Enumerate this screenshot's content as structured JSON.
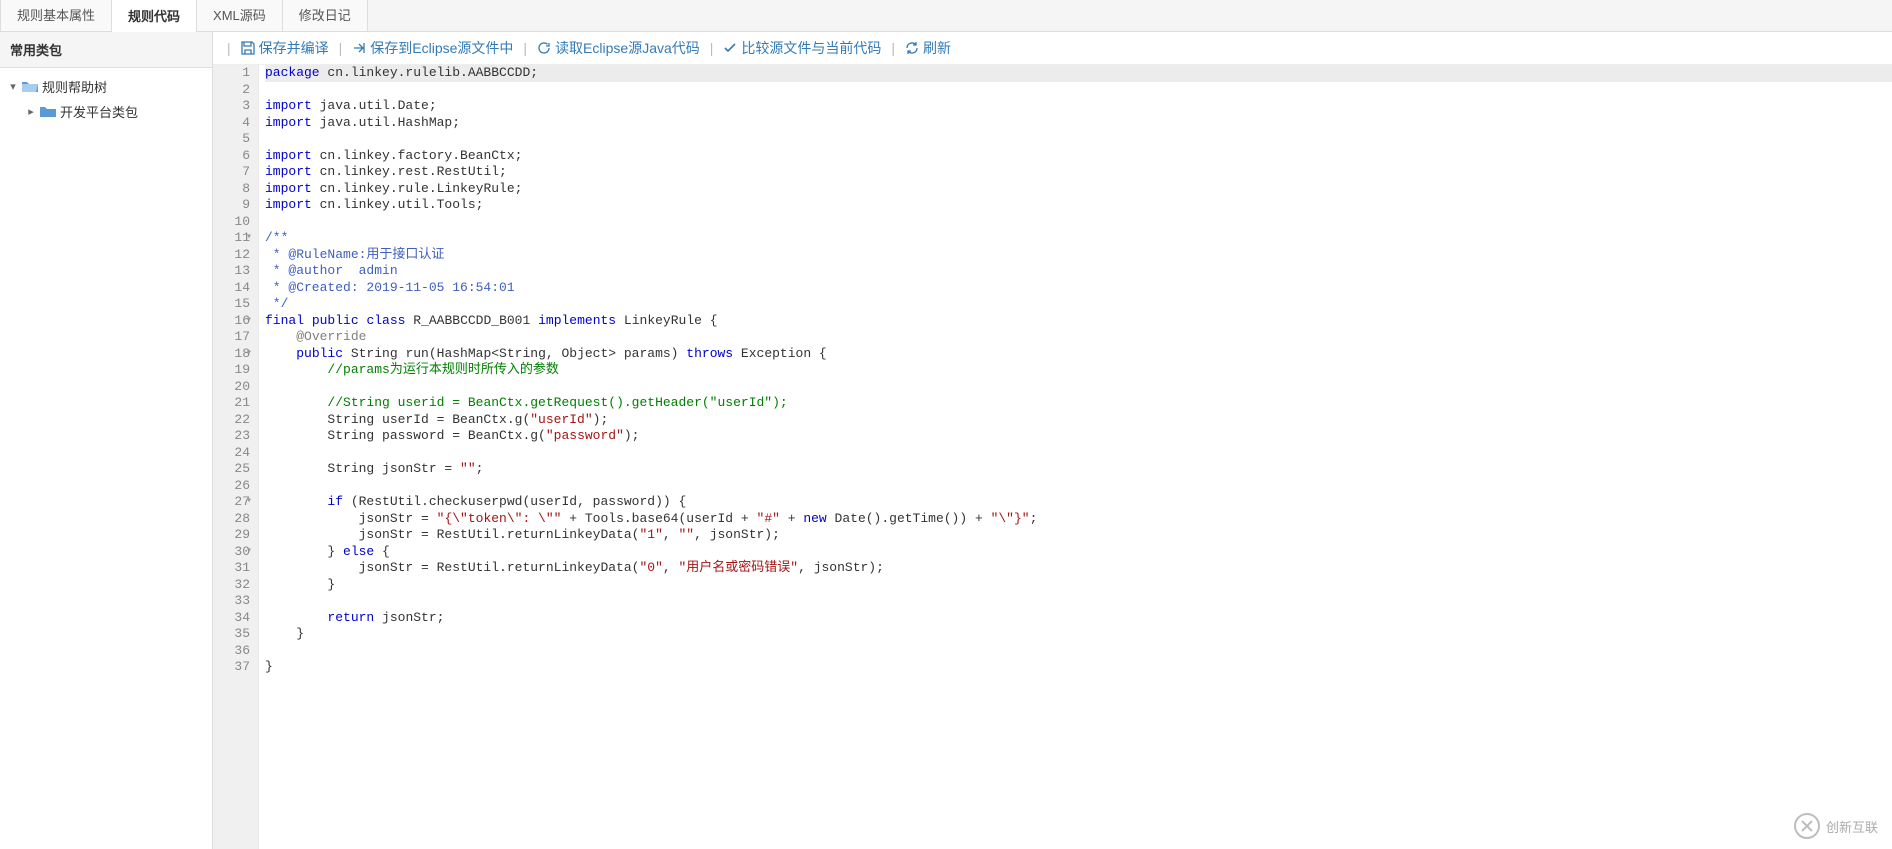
{
  "tabs": [
    {
      "label": "规则基本属性"
    },
    {
      "label": "规则代码"
    },
    {
      "label": "XML源码"
    },
    {
      "label": "修改日记"
    }
  ],
  "activeTabIndex": 1,
  "sidebar": {
    "header": "常用类包",
    "tree": {
      "root": {
        "label": "规则帮助树"
      },
      "child": {
        "label": "开发平台类包"
      }
    }
  },
  "toolbar": {
    "saveCompile": "保存并编译",
    "saveToEclipse": "保存到Eclipse源文件中",
    "readEclipse": "读取Eclipse源Java代码",
    "compareSource": "比较源文件与当前代码",
    "refresh": "刷新"
  },
  "code": {
    "highlightLine": 1,
    "foldLines": [
      11,
      16,
      18,
      27,
      30
    ],
    "lines": [
      {
        "n": 1,
        "t": [
          {
            "c": "kw",
            "v": "package"
          },
          {
            "c": "",
            "v": " cn.linkey.rulelib.AABBCCDD;"
          }
        ]
      },
      {
        "n": 2,
        "t": []
      },
      {
        "n": 3,
        "t": [
          {
            "c": "kw",
            "v": "import"
          },
          {
            "c": "",
            "v": " java.util.Date;"
          }
        ]
      },
      {
        "n": 4,
        "t": [
          {
            "c": "kw",
            "v": "import"
          },
          {
            "c": "",
            "v": " java.util.HashMap;"
          }
        ]
      },
      {
        "n": 5,
        "t": []
      },
      {
        "n": 6,
        "t": [
          {
            "c": "kw",
            "v": "import"
          },
          {
            "c": "",
            "v": " cn.linkey.factory.BeanCtx;"
          }
        ]
      },
      {
        "n": 7,
        "t": [
          {
            "c": "kw",
            "v": "import"
          },
          {
            "c": "",
            "v": " cn.linkey.rest.RestUtil;"
          }
        ]
      },
      {
        "n": 8,
        "t": [
          {
            "c": "kw",
            "v": "import"
          },
          {
            "c": "",
            "v": " cn.linkey.rule.LinkeyRule;"
          }
        ]
      },
      {
        "n": 9,
        "t": [
          {
            "c": "kw",
            "v": "import"
          },
          {
            "c": "",
            "v": " cn.linkey.util.Tools;"
          }
        ]
      },
      {
        "n": 10,
        "t": []
      },
      {
        "n": 11,
        "t": [
          {
            "c": "jdoc",
            "v": "/**"
          }
        ]
      },
      {
        "n": 12,
        "t": [
          {
            "c": "jdoc",
            "v": " * @RuleName:用于接口认证"
          }
        ]
      },
      {
        "n": 13,
        "t": [
          {
            "c": "jdoc",
            "v": " * @author  admin"
          }
        ]
      },
      {
        "n": 14,
        "t": [
          {
            "c": "jdoc",
            "v": " * @Created: 2019-11-05 16:54:01"
          }
        ]
      },
      {
        "n": 15,
        "t": [
          {
            "c": "jdoc",
            "v": " */"
          }
        ]
      },
      {
        "n": 16,
        "t": [
          {
            "c": "kw",
            "v": "final"
          },
          {
            "c": "",
            "v": " "
          },
          {
            "c": "kw",
            "v": "public"
          },
          {
            "c": "",
            "v": " "
          },
          {
            "c": "kw",
            "v": "class"
          },
          {
            "c": "",
            "v": " R_AABBCCDD_B001 "
          },
          {
            "c": "kw",
            "v": "implements"
          },
          {
            "c": "",
            "v": " LinkeyRule {"
          }
        ]
      },
      {
        "n": 17,
        "t": [
          {
            "c": "",
            "v": "    "
          },
          {
            "c": "ann",
            "v": "@Override"
          }
        ]
      },
      {
        "n": 18,
        "t": [
          {
            "c": "",
            "v": "    "
          },
          {
            "c": "kw",
            "v": "public"
          },
          {
            "c": "",
            "v": " String run(HashMap<String, Object> params) "
          },
          {
            "c": "kw",
            "v": "throws"
          },
          {
            "c": "",
            "v": " Exception {"
          }
        ]
      },
      {
        "n": 19,
        "t": [
          {
            "c": "",
            "v": "        "
          },
          {
            "c": "cmt",
            "v": "//params为运行本规则时所传入的参数"
          }
        ]
      },
      {
        "n": 20,
        "t": []
      },
      {
        "n": 21,
        "t": [
          {
            "c": "",
            "v": "        "
          },
          {
            "c": "cmt",
            "v": "//String userid = BeanCtx.getRequest().getHeader(\"userId\");"
          }
        ]
      },
      {
        "n": 22,
        "t": [
          {
            "c": "",
            "v": "        String userId = BeanCtx.g("
          },
          {
            "c": "str",
            "v": "\"userId\""
          },
          {
            "c": "",
            "v": ");"
          }
        ]
      },
      {
        "n": 23,
        "t": [
          {
            "c": "",
            "v": "        String password = BeanCtx.g("
          },
          {
            "c": "str",
            "v": "\"password\""
          },
          {
            "c": "",
            "v": ");"
          }
        ]
      },
      {
        "n": 24,
        "t": []
      },
      {
        "n": 25,
        "t": [
          {
            "c": "",
            "v": "        String jsonStr = "
          },
          {
            "c": "str",
            "v": "\"\""
          },
          {
            "c": "",
            "v": ";"
          }
        ]
      },
      {
        "n": 26,
        "t": []
      },
      {
        "n": 27,
        "t": [
          {
            "c": "",
            "v": "        "
          },
          {
            "c": "kw",
            "v": "if"
          },
          {
            "c": "",
            "v": " (RestUtil.checkuserpwd(userId, password)) {"
          }
        ]
      },
      {
        "n": 28,
        "t": [
          {
            "c": "",
            "v": "            jsonStr = "
          },
          {
            "c": "str",
            "v": "\"{\\\"token\\\": \\\"\""
          },
          {
            "c": "",
            "v": " + Tools.base64(userId + "
          },
          {
            "c": "str",
            "v": "\"#\""
          },
          {
            "c": "",
            "v": " + "
          },
          {
            "c": "kw",
            "v": "new"
          },
          {
            "c": "",
            "v": " Date().getTime()) + "
          },
          {
            "c": "str",
            "v": "\"\\\"}\""
          },
          {
            "c": "",
            "v": ";"
          }
        ]
      },
      {
        "n": 29,
        "t": [
          {
            "c": "",
            "v": "            jsonStr = RestUtil.returnLinkeyData("
          },
          {
            "c": "str",
            "v": "\"1\""
          },
          {
            "c": "",
            "v": ", "
          },
          {
            "c": "str",
            "v": "\"\""
          },
          {
            "c": "",
            "v": ", jsonStr);"
          }
        ]
      },
      {
        "n": 30,
        "t": [
          {
            "c": "",
            "v": "        } "
          },
          {
            "c": "kw",
            "v": "else"
          },
          {
            "c": "",
            "v": " {"
          }
        ]
      },
      {
        "n": 31,
        "t": [
          {
            "c": "",
            "v": "            jsonStr = RestUtil.returnLinkeyData("
          },
          {
            "c": "str",
            "v": "\"0\""
          },
          {
            "c": "",
            "v": ", "
          },
          {
            "c": "str",
            "v": "\"用户名或密码错误\""
          },
          {
            "c": "",
            "v": ", jsonStr);"
          }
        ]
      },
      {
        "n": 32,
        "t": [
          {
            "c": "",
            "v": "        }"
          }
        ]
      },
      {
        "n": 33,
        "t": []
      },
      {
        "n": 34,
        "t": [
          {
            "c": "",
            "v": "        "
          },
          {
            "c": "kw",
            "v": "return"
          },
          {
            "c": "",
            "v": " jsonStr;"
          }
        ]
      },
      {
        "n": 35,
        "t": [
          {
            "c": "",
            "v": "    }"
          }
        ]
      },
      {
        "n": 36,
        "t": []
      },
      {
        "n": 37,
        "t": [
          {
            "c": "",
            "v": "}"
          }
        ]
      }
    ]
  },
  "watermark": {
    "text": "创新互联"
  }
}
